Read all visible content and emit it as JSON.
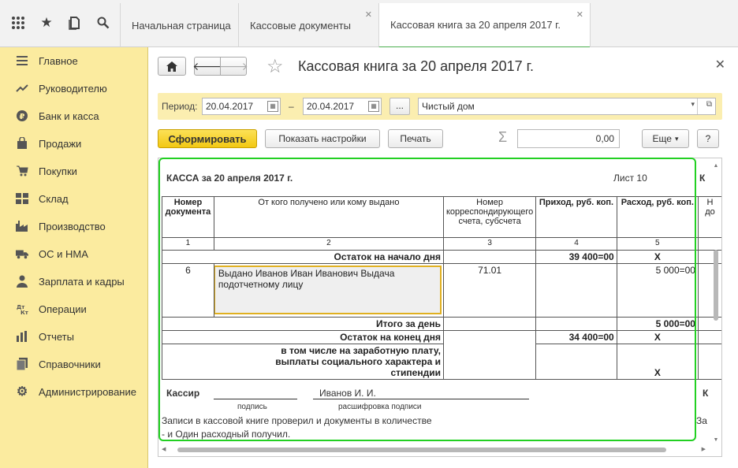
{
  "tabs": [
    {
      "label": "Начальная страница"
    },
    {
      "label": "Кассовые документы"
    },
    {
      "label": "Кассовая книга за 20 апреля 2017 г."
    }
  ],
  "sidebar": {
    "items": [
      {
        "label": "Главное",
        "icon": "menu-lines-icon"
      },
      {
        "label": "Руководителю",
        "icon": "trend-icon"
      },
      {
        "label": "Банк и касса",
        "icon": "ruble-icon"
      },
      {
        "label": "Продажи",
        "icon": "bag-icon"
      },
      {
        "label": "Покупки",
        "icon": "cart-icon"
      },
      {
        "label": "Склад",
        "icon": "warehouse-icon"
      },
      {
        "label": "Производство",
        "icon": "factory-icon"
      },
      {
        "label": "ОС и НМА",
        "icon": "truck-icon"
      },
      {
        "label": "Зарплата и кадры",
        "icon": "people-icon"
      },
      {
        "label": "Операции",
        "icon": "dt-kt-icon"
      },
      {
        "label": "Отчеты",
        "icon": "bar-chart-icon"
      },
      {
        "label": "Справочники",
        "icon": "book-icon"
      },
      {
        "label": "Администрирование",
        "icon": "gear-icon"
      }
    ]
  },
  "document": {
    "title": "Кассовая книга за 20 апреля 2017 г."
  },
  "params": {
    "period_label": "Период:",
    "date_from": "20.04.2017",
    "dash": "–",
    "date_to": "20.04.2017",
    "ellipsis": "...",
    "organization": "Чистый дом"
  },
  "toolbar": {
    "generate": "Сформировать",
    "show_settings": "Показать настройки",
    "print": "Печать",
    "sum_value": "0,00",
    "more": "Еще",
    "help": "?"
  },
  "report": {
    "heading": "КАССА за 20 апреля 2017 г.",
    "sheet": "Лист 10",
    "col_headers": [
      "Номер документа",
      "От кого получено или кому выдано",
      "Номер корреспондирующего счета, субсчета",
      "Приход, руб. коп.",
      "Расход, руб. коп."
    ],
    "col_nums": [
      "1",
      "2",
      "3",
      "4",
      "5"
    ],
    "opening_label": "Остаток на начало дня",
    "opening_income": "39 400=00",
    "opening_expense": "Х",
    "row_doc": "6",
    "row_desc": "Выдано Иванов Иван Иванович Выдача подотчетному лицу",
    "row_account": "71.01",
    "row_expense": "5 000=00",
    "day_total_label": "Итого за день",
    "day_total_expense": "5 000=00",
    "closing_label": "Остаток на конец  дня",
    "closing_income": "34 400=00",
    "closing_expense": "Х",
    "incl_label": "в том числе на заработную плату, выплаты социального характера и стипендии",
    "incl_expense": "Х",
    "cashier_label": "Кассир",
    "signature_caption": "подпись",
    "cashier_name": "Иванов И. И.",
    "decoding_caption": "расшифровка подписи",
    "check_line1": "Записи в кассовой книге проверил и документы в количестве",
    "check_line2": "-  и Один расходный получил.",
    "right_cut_1": "К",
    "right_cut_2": "Н",
    "right_cut_3": "до",
    "right_cut_4": "К",
    "right_cut_5": "За"
  }
}
